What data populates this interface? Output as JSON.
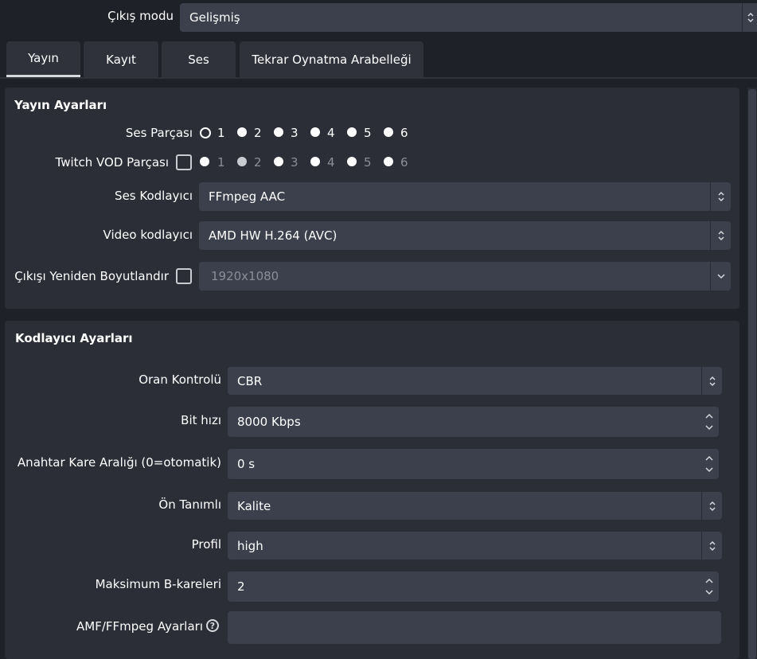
{
  "output_mode": {
    "label": "Çıkış modu",
    "value": "Gelişmiş"
  },
  "tabs": [
    {
      "label": "Yayın",
      "active": true
    },
    {
      "label": "Kayıt"
    },
    {
      "label": "Ses"
    },
    {
      "label": "Tekrar Oynatma Arabelleği"
    }
  ],
  "stream_settings": {
    "title": "Yayın Ayarları",
    "audio_track": {
      "label": "Ses Parçası",
      "options": [
        "1",
        "2",
        "3",
        "4",
        "5",
        "6"
      ],
      "selected": "1"
    },
    "twitch_vod": {
      "label": "Twitch VOD Parçası",
      "checked": false,
      "options": [
        "1",
        "2",
        "3",
        "4",
        "5",
        "6"
      ],
      "selected": "2"
    },
    "audio_encoder": {
      "label": "Ses Kodlayıcı",
      "value": "FFmpeg AAC"
    },
    "video_encoder": {
      "label": "Video kodlayıcı",
      "value": "AMD HW H.264 (AVC)"
    },
    "rescale": {
      "label": "Çıkışı Yeniden Boyutlandır",
      "checked": false,
      "value": "1920x1080"
    }
  },
  "encoder_settings": {
    "title": "Kodlayıcı Ayarları",
    "rate_control": {
      "label": "Oran Kontrolü",
      "value": "CBR"
    },
    "bitrate": {
      "label": "Bit hızı",
      "value": "8000 Kbps"
    },
    "keyframe": {
      "label": "Anahtar Kare Aralığı (0=otomatik)",
      "value": "0 s"
    },
    "preset": {
      "label": "Ön Tanımlı",
      "value": "Kalite"
    },
    "profile": {
      "label": "Profil",
      "value": "high"
    },
    "max_bframes": {
      "label": "Maksimum B-kareleri",
      "value": "2"
    },
    "amf_options": {
      "label": "AMF/FFmpeg Ayarları",
      "value": ""
    }
  }
}
